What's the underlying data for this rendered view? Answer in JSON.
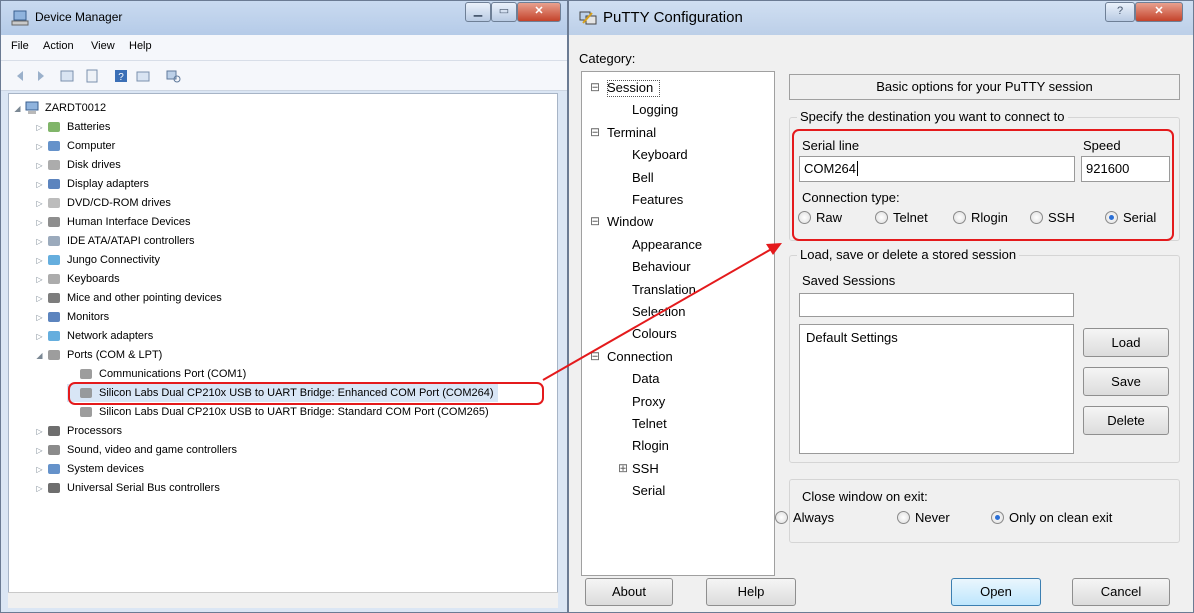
{
  "device_manager": {
    "title": "Device Manager",
    "menu": [
      "File",
      "Action",
      "View",
      "Help"
    ],
    "computer_name": "ZARDT0012",
    "nodes": [
      {
        "label": "Batteries",
        "expander": "▷",
        "icon": "battery-icon"
      },
      {
        "label": "Computer",
        "expander": "▷",
        "icon": "computer-icon"
      },
      {
        "label": "Disk drives",
        "expander": "▷",
        "icon": "disk-drive-icon"
      },
      {
        "label": "Display adapters",
        "expander": "▷",
        "icon": "display-adapter-icon"
      },
      {
        "label": "DVD/CD-ROM drives",
        "expander": "▷",
        "icon": "dvd-drive-icon"
      },
      {
        "label": "Human Interface Devices",
        "expander": "▷",
        "icon": "hid-icon"
      },
      {
        "label": "IDE ATA/ATAPI controllers",
        "expander": "▷",
        "icon": "ide-controller-icon"
      },
      {
        "label": "Jungo Connectivity",
        "expander": "▷",
        "icon": "jungo-icon"
      },
      {
        "label": "Keyboards",
        "expander": "▷",
        "icon": "keyboard-icon"
      },
      {
        "label": "Mice and other pointing devices",
        "expander": "▷",
        "icon": "mouse-icon"
      },
      {
        "label": "Monitors",
        "expander": "▷",
        "icon": "monitor-icon"
      },
      {
        "label": "Network adapters",
        "expander": "▷",
        "icon": "network-adapter-icon"
      },
      {
        "label": "Ports (COM & LPT)",
        "expander": "◢",
        "icon": "port-icon"
      },
      {
        "label": "Communications Port (COM1)",
        "expander": "",
        "icon": "port-icon",
        "child": true
      },
      {
        "label": "Silicon Labs Dual CP210x USB to UART Bridge: Enhanced COM Port (COM264)",
        "expander": "",
        "icon": "port-icon",
        "child": true,
        "selected": true
      },
      {
        "label": "Silicon Labs Dual CP210x USB to UART Bridge: Standard COM Port (COM265)",
        "expander": "",
        "icon": "port-icon",
        "child": true
      },
      {
        "label": "Processors",
        "expander": "▷",
        "icon": "processor-icon"
      },
      {
        "label": "Sound, video and game controllers",
        "expander": "▷",
        "icon": "sound-icon"
      },
      {
        "label": "System devices",
        "expander": "▷",
        "icon": "system-device-icon"
      },
      {
        "label": "Universal Serial Bus controllers",
        "expander": "▷",
        "icon": "usb-icon"
      }
    ]
  },
  "putty": {
    "title": "PuTTY Configuration",
    "category_label": "Category:",
    "categories": [
      {
        "label": "Session",
        "level": 0,
        "exp": "⊟"
      },
      {
        "label": "Logging",
        "level": 1
      },
      {
        "label": "Terminal",
        "level": 0,
        "exp": "⊟"
      },
      {
        "label": "Keyboard",
        "level": 1
      },
      {
        "label": "Bell",
        "level": 1
      },
      {
        "label": "Features",
        "level": 1
      },
      {
        "label": "Window",
        "level": 0,
        "exp": "⊟"
      },
      {
        "label": "Appearance",
        "level": 1
      },
      {
        "label": "Behaviour",
        "level": 1
      },
      {
        "label": "Translation",
        "level": 1
      },
      {
        "label": "Selection",
        "level": 1
      },
      {
        "label": "Colours",
        "level": 1
      },
      {
        "label": "Connection",
        "level": 0,
        "exp": "⊟"
      },
      {
        "label": "Data",
        "level": 1
      },
      {
        "label": "Proxy",
        "level": 1
      },
      {
        "label": "Telnet",
        "level": 1
      },
      {
        "label": "Rlogin",
        "level": 1
      },
      {
        "label": "SSH",
        "level": 1,
        "exp": "⊞"
      },
      {
        "label": "Serial",
        "level": 1
      }
    ],
    "header": "Basic options for your PuTTY session",
    "destination_label": "Specify the destination you want to connect to",
    "serial_line_label": "Serial line",
    "serial_line_value": "COM264",
    "speed_label": "Speed",
    "speed_value": "921600",
    "connection_type_label": "Connection type:",
    "connection_types": [
      {
        "label": "Raw",
        "selected": false
      },
      {
        "label": "Telnet",
        "selected": false
      },
      {
        "label": "Rlogin",
        "selected": false
      },
      {
        "label": "SSH",
        "selected": false
      },
      {
        "label": "Serial",
        "selected": true
      }
    ],
    "sessions_group_label": "Load, save or delete a stored session",
    "saved_sessions_label": "Saved Sessions",
    "saved_session_input": "",
    "sessions": [
      "Default Settings"
    ],
    "load_label": "Load",
    "save_label": "Save",
    "delete_label": "Delete",
    "close_window_label": "Close window on exit:",
    "close_options": [
      {
        "label": "Always",
        "selected": false
      },
      {
        "label": "Never",
        "selected": false
      },
      {
        "label": "Only on clean exit",
        "selected": true
      }
    ],
    "about_label": "About",
    "help_label": "Help",
    "help_glyph": "?",
    "open_label": "Open",
    "cancel_label": "Cancel"
  },
  "colors": {
    "highlight": "#e41a1c",
    "selection_bg": "#d8e6f6"
  }
}
